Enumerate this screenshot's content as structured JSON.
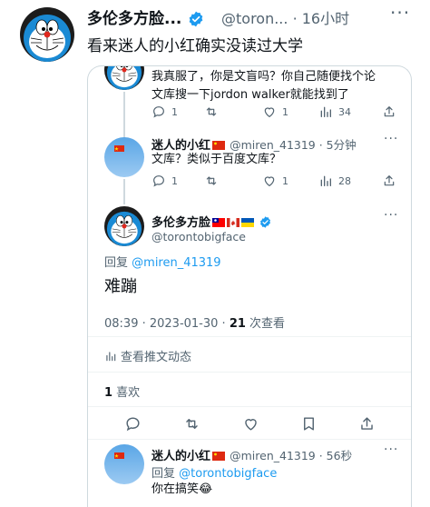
{
  "outer": {
    "name": "多伦多方脸...",
    "handle": "@toron...",
    "time": "· 16小时",
    "more": "···",
    "text": "看来迷人的小红确实没读过大学"
  },
  "reply_prev": {
    "text_line1": "我真服了，你是文盲吗？你自己随便找个论",
    "text_line2": "文库搜一下jordon walker就能找到了",
    "replies": "1",
    "likes": "1",
    "views": "34"
  },
  "reply_miren": {
    "name": "迷人的小红",
    "handle": "@miren_41319 · 5分钟",
    "text": "文库？类似于百度文库？",
    "replies": "1",
    "likes": "1",
    "views": "28"
  },
  "main": {
    "name": "多伦多方脸",
    "handle": "@torontobigface",
    "reply_prefix": "回复",
    "reply_to": "@miren_41319",
    "text": "难蹦",
    "timestamp": "08:39 · 2023-01-30 · ",
    "views_count": "21",
    "views_label": " 次查看",
    "activity": "查看推文动态",
    "likes_count": "1",
    "likes_label": " 喜欢"
  },
  "bottom_reply": {
    "name": "迷人的小红",
    "handle": "@miren_41319 · 56秒",
    "reply_prefix": "回复",
    "reply_to": "@torontobigface",
    "text": "你在搞笑😂"
  },
  "colors": {
    "accent": "#1d9bf0",
    "text": "#0f1419",
    "muted": "#536471",
    "border": "#cfd9de"
  }
}
